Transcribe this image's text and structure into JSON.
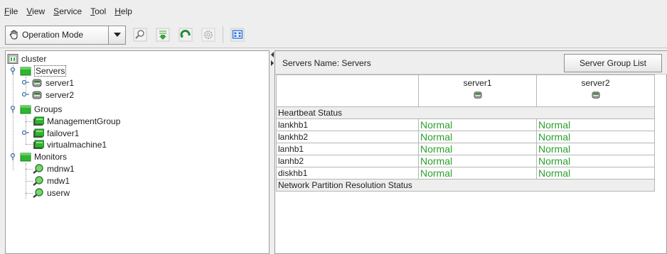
{
  "menu": [
    {
      "mnemonic": "F",
      "rest": "ile"
    },
    {
      "mnemonic": "V",
      "rest": "iew"
    },
    {
      "mnemonic": "S",
      "rest": "ervice"
    },
    {
      "mnemonic": "T",
      "rest": "ool"
    },
    {
      "mnemonic": "H",
      "rest": "elp"
    }
  ],
  "toolbar": {
    "mode_label": "Operation Mode",
    "icons": [
      "find-icon",
      "download-icon",
      "refresh-icon",
      "settings-icon",
      "integrated-manager-icon"
    ]
  },
  "tree": {
    "root": "cluster",
    "servers_label": "Servers",
    "servers": [
      "server1",
      "server2"
    ],
    "groups_label": "Groups",
    "groups": [
      "ManagementGroup",
      "failover1",
      "virtualmachine1"
    ],
    "monitors_label": "Monitors",
    "monitors": [
      "mdnw1",
      "mdw1",
      "userw"
    ]
  },
  "right": {
    "servers_name": "Servers Name: Servers",
    "group_list_button": "Server Group List",
    "columns": [
      "server1",
      "server2"
    ],
    "heartbeat_section": "Heartbeat Status",
    "rows": [
      {
        "name": "lankhb1",
        "server1": "Normal",
        "server2": "Normal"
      },
      {
        "name": "lankhb2",
        "server1": "Normal",
        "server2": "Normal"
      },
      {
        "name": "lanhb1",
        "server1": "Normal",
        "server2": "Normal"
      },
      {
        "name": "lanhb2",
        "server1": "Normal",
        "server2": "Normal"
      },
      {
        "name": "diskhb1",
        "server1": "Normal",
        "server2": "Normal"
      }
    ],
    "network_section": "Network Partition Resolution Status"
  },
  "colors": {
    "normal_text": "#2ca02c",
    "folder_green": "#2fb52f",
    "panel_bg": "#eeeeee"
  }
}
